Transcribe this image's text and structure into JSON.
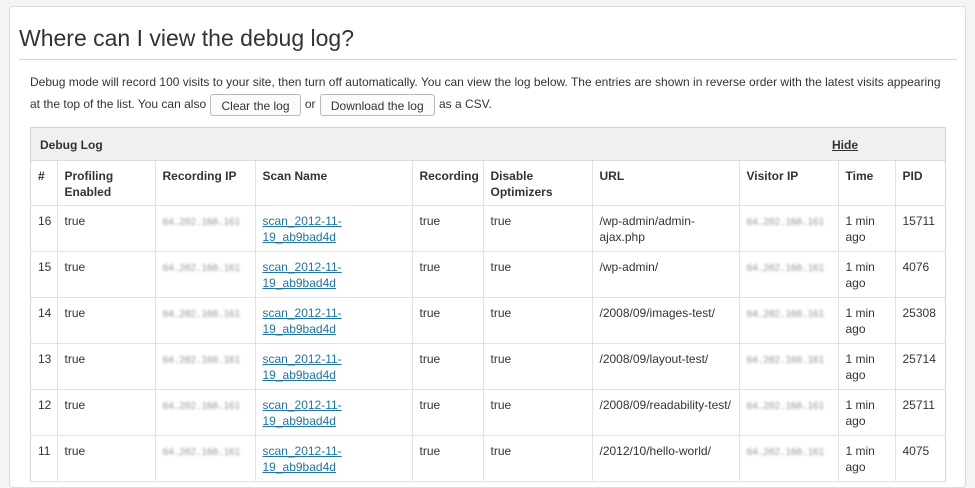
{
  "heading": "Where can I view the debug log?",
  "description": {
    "text_before": "Debug mode will record 100 visits to your site, then turn off automatically. You can view the log below. The entries are shown in reverse order with the latest visits appearing at the top of the list. You can also",
    "clear_button": "Clear the log",
    "or": "or",
    "download_button": "Download the log",
    "text_after": "as a CSV."
  },
  "log": {
    "title": "Debug Log",
    "hide_label": "Hide",
    "columns": [
      "#",
      "Profiling Enabled",
      "Recording IP",
      "Scan Name",
      "Recording",
      "Disable Optimizers",
      "URL",
      "Visitor IP",
      "Time",
      "PID"
    ],
    "rows": [
      {
        "num": "16",
        "profiling": "true",
        "recording_ip": "64.202.160.161",
        "scan": "scan_2012-11-19_ab9bad4d",
        "recording": "true",
        "disable": "true",
        "url": "/wp-admin/admin-ajax.php",
        "visitor_ip": "64.202.160.161",
        "time": "1 min ago",
        "pid": "15711"
      },
      {
        "num": "15",
        "profiling": "true",
        "recording_ip": "64.202.160.161",
        "scan": "scan_2012-11-19_ab9bad4d",
        "recording": "true",
        "disable": "true",
        "url": "/wp-admin/",
        "visitor_ip": "64.202.160.161",
        "time": "1 min ago",
        "pid": "4076"
      },
      {
        "num": "14",
        "profiling": "true",
        "recording_ip": "64.202.160.161",
        "scan": "scan_2012-11-19_ab9bad4d",
        "recording": "true",
        "disable": "true",
        "url": "/2008/09/images-test/",
        "visitor_ip": "64.202.160.161",
        "time": "1 min ago",
        "pid": "25308"
      },
      {
        "num": "13",
        "profiling": "true",
        "recording_ip": "64.202.160.161",
        "scan": "scan_2012-11-19_ab9bad4d",
        "recording": "true",
        "disable": "true",
        "url": "/2008/09/layout-test/",
        "visitor_ip": "64.202.160.161",
        "time": "1 min ago",
        "pid": "25714"
      },
      {
        "num": "12",
        "profiling": "true",
        "recording_ip": "64.202.160.161",
        "scan": "scan_2012-11-19_ab9bad4d",
        "recording": "true",
        "disable": "true",
        "url": "/2008/09/readability-test/",
        "visitor_ip": "64.202.160.161",
        "time": "1 min ago",
        "pid": "25711"
      },
      {
        "num": "11",
        "profiling": "true",
        "recording_ip": "64.202.160.161",
        "scan": "scan_2012-11-19_ab9bad4d",
        "recording": "true",
        "disable": "true",
        "url": "/2012/10/hello-world/",
        "visitor_ip": "64.202.160.161",
        "time": "1 min ago",
        "pid": "4075"
      }
    ]
  }
}
